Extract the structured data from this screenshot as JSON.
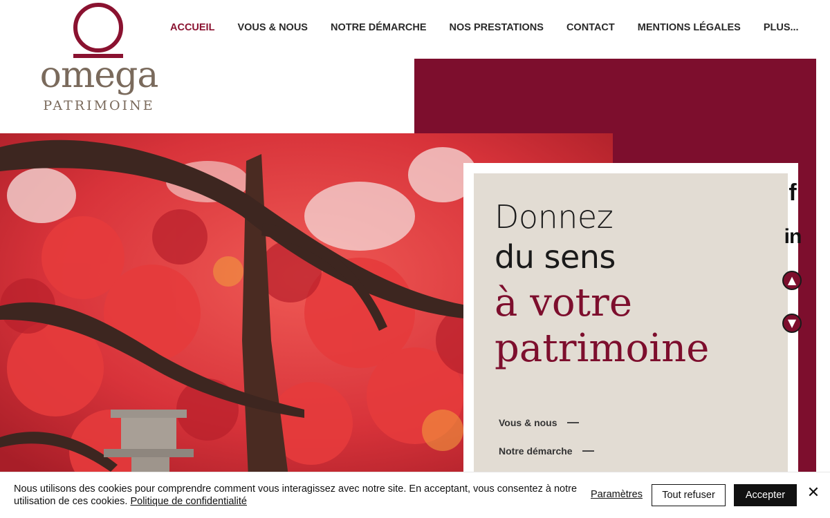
{
  "logo": {
    "word": "omega",
    "sub": "PATRIMOINE"
  },
  "nav": {
    "items": [
      {
        "label": "ACCUEIL",
        "active": true
      },
      {
        "label": "VOUS & NOUS"
      },
      {
        "label": "NOTRE DÉMARCHE"
      },
      {
        "label": "NOS PRESTATIONS"
      },
      {
        "label": "CONTACT"
      },
      {
        "label": "MENTIONS LÉGALES"
      },
      {
        "label": "PLUS..."
      }
    ]
  },
  "hero": {
    "line1": "Donnez",
    "line2": "du sens",
    "line3": "à votre",
    "line4": "patrimoine",
    "links": [
      "Vous & nous",
      "Notre démarche"
    ]
  },
  "social": {
    "facebook": "f",
    "linkedin": "in"
  },
  "cookie": {
    "text": "Nous utilisons des cookies pour comprendre comment vous interagissez avec notre site. En acceptant, vous consentez à notre utilisation de ces cookies.",
    "policy": "Politique de confidentialité",
    "params": "Paramètres",
    "refuse": "Tout refuser",
    "accept": "Accepter",
    "close": "✕"
  },
  "colors": {
    "accent": "#7d0e2d",
    "logo_text": "#7a6a5c",
    "beige": "#e2dcd3"
  },
  "icons": [
    "facebook-icon",
    "linkedin-icon",
    "arrow-up-icon",
    "arrow-down-icon",
    "close-icon"
  ]
}
